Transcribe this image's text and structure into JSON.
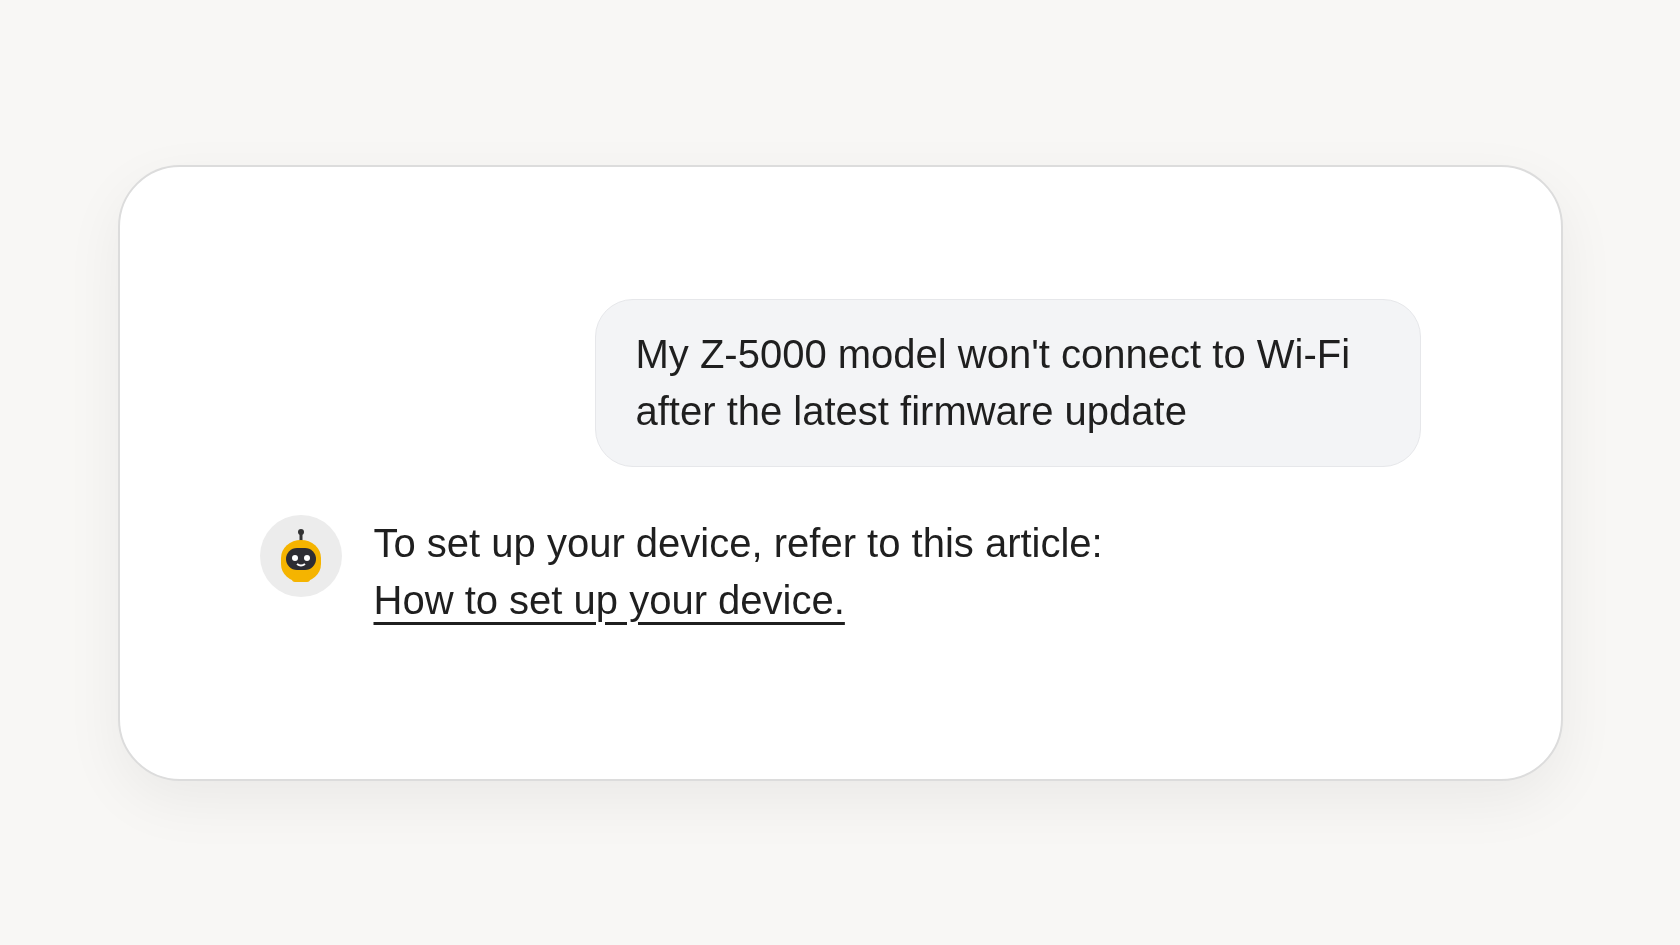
{
  "messages": [
    {
      "kind": "user",
      "text": "My Z-5000 model won't connect to Wi-Fi after the latest firmware update"
    },
    {
      "kind": "bot",
      "text": "To set up your device, refer to this article:",
      "link": "How to set up your device."
    }
  ]
}
